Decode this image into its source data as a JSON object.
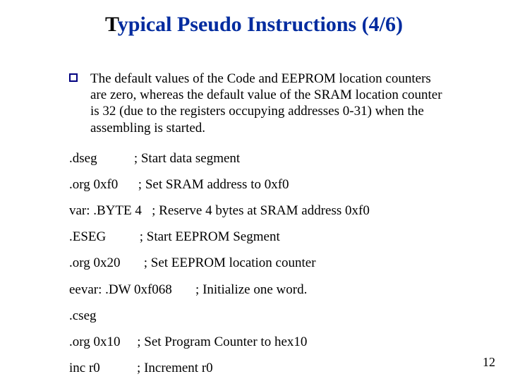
{
  "title": {
    "prefix": "T",
    "rest": "ypical Pseudo Instructions (4/6)"
  },
  "bullet": "The default values of the Code and EEPROM location counters are zero, whereas the default value of the SRAM location counter is 32 (due to the registers occupying addresses 0-31) when the assembling is started.",
  "lines": {
    "l0": ".dseg           ; Start data segment",
    "l1": ".org 0xf0      ; Set SRAM address to 0xf0",
    "l2": "var: .BYTE 4   ; Reserve 4 bytes at SRAM address 0xf0",
    "l3": ".ESEG          ; Start EEPROM Segment",
    "l4": ".org 0x20       ; Set EEPROM location counter",
    "l5": "eevar: .DW 0xf068       ; Initialize one word.",
    "l6": ".cseg",
    "l7": ".org 0x10     ; Set Program Counter to hex10",
    "l8": "inc r0           ; Increment r0"
  },
  "page": "12"
}
